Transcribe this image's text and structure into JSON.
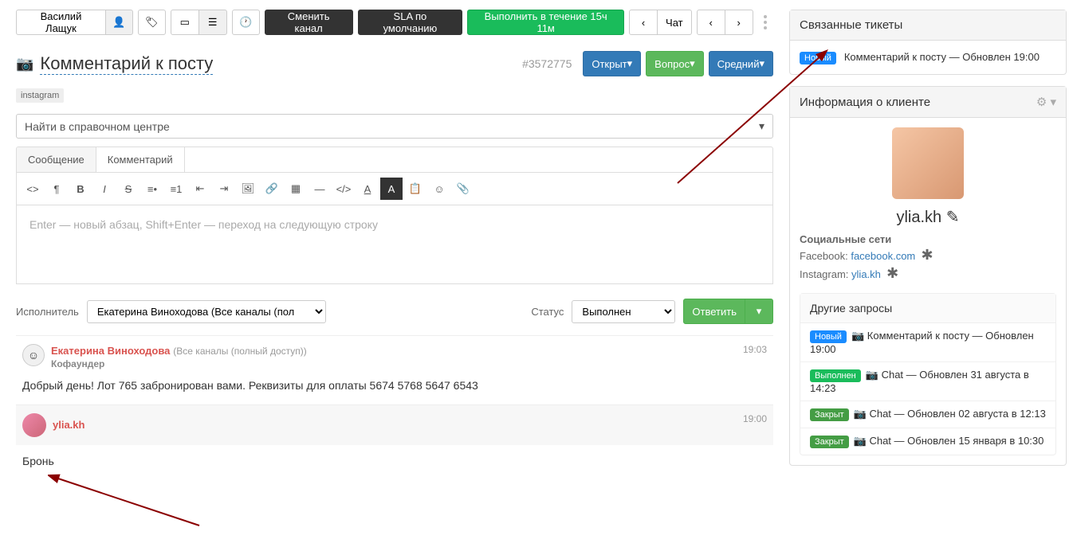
{
  "toolbar": {
    "user": "Василий Лащук",
    "change_channel": "Сменить канал",
    "sla": "SLA по умолчанию",
    "deadline": "Выполнить в течение 15ч 11м",
    "chat": "Чат"
  },
  "ticket": {
    "title": "Комментарий к посту",
    "id": "#3572775",
    "status": "Открыт",
    "type": "Вопрос",
    "priority": "Средний",
    "tag": "instagram"
  },
  "search_placeholder": "Найти в справочном центре",
  "tabs": {
    "message": "Сообщение",
    "comment": "Комментарий"
  },
  "editor": {
    "placeholder": "Enter — новый абзац, Shift+Enter — переход на следующую строку"
  },
  "reply": {
    "assignee_label": "Исполнитель",
    "assignee": "Екатерина Виноходова (Все каналы (полный …",
    "status_label": "Статус",
    "status": "Выполнен",
    "submit": "Ответить"
  },
  "messages": [
    {
      "author": "Екатерина Виноходова",
      "role_inline": "(Все каналы (полный доступ))",
      "subtitle": "Кофаундер",
      "time": "19:03",
      "body": "Добрый день! Лот 765 забронирован вами. Реквизиты для оплаты 5674 5768 5647 6543"
    },
    {
      "author": "ylia.kh",
      "time": "19:00",
      "body": "Бронь"
    }
  ],
  "sidebar": {
    "related_title": "Связанные тикеты",
    "related": {
      "badge": "Новый",
      "text": "Комментарий к посту — Обновлен 19:00"
    },
    "client_title": "Информация о клиенте",
    "client": {
      "name": "ylia.kh",
      "social_label": "Социальные сети",
      "fb_label": "Facebook:",
      "fb_value": "facebook.com",
      "ig_label": "Instagram:",
      "ig_value": "ylia.kh"
    },
    "other_title": "Другие запросы",
    "other": [
      {
        "badge": "Новый",
        "badge_class": "badge-blue",
        "icon": "camera",
        "text": "Комментарий к посту — Обновлен 19:00"
      },
      {
        "badge": "Выполнен",
        "badge_class": "badge-green",
        "icon": "camera",
        "text": "Chat — Обновлен 31 августа в 14:23"
      },
      {
        "badge": "Закрыт",
        "badge_class": "badge-dgreen",
        "icon": "camera",
        "text": "Chat — Обновлен 02 августа в 12:13"
      },
      {
        "badge": "Закрыт",
        "badge_class": "badge-dgreen",
        "icon": "camera",
        "text": "Chat — Обновлен 15 января в 10:30"
      }
    ]
  }
}
